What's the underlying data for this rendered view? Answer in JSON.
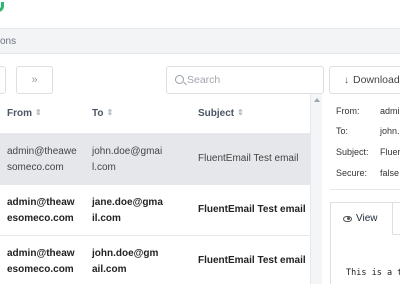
{
  "breadcrumb": {
    "text": "ons"
  },
  "toolbar": {
    "next_label": "»",
    "search_placeholder": "Search",
    "download_icon": "↓",
    "download_label": "Download"
  },
  "table": {
    "columns": [
      "From",
      "To",
      "Subject"
    ],
    "sort_icon": "⇕",
    "rows": [
      {
        "from": [
          "admin@theawe",
          "someco.com"
        ],
        "to": [
          "john.doe@gmai",
          "l.com"
        ],
        "subject": "FluentEmail Test email",
        "selected": true,
        "unread": false
      },
      {
        "from": [
          "admin@theaw",
          "esomeco.com"
        ],
        "to": [
          "jane.doe@gma",
          "il.com"
        ],
        "subject": "FluentEmail Test email",
        "selected": false,
        "unread": true
      },
      {
        "from": [
          "admin@theaw",
          "esomeco.com"
        ],
        "to": [
          "john.doe@gm",
          "ail.com"
        ],
        "subject": "FluentEmail Test email",
        "selected": false,
        "unread": true
      }
    ]
  },
  "details": {
    "from_label": "From:",
    "from_value": "admi",
    "to_label": "To:",
    "to_value": "john.",
    "subject_label": "Subject:",
    "subject_value": "Fluer",
    "secure_label": "Secure:",
    "secure_value": "false"
  },
  "tabs": {
    "view_label": "View"
  },
  "body_preview": "This is a t"
}
